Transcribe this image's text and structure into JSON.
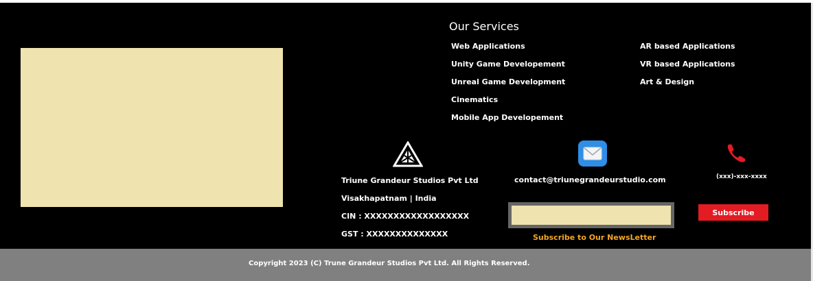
{
  "colors": {
    "background": "#000000",
    "placeholder": "#efe4b0",
    "subscribe_button": "#e31b23",
    "newsletter_caption": "#f5a623",
    "bottom_bar": "#808080"
  },
  "services": {
    "title": "Our Services",
    "left_column": [
      "Web Applications",
      "Unity Game Developement",
      "Unreal Game Development",
      "Cinematics",
      "Mobile App Developement"
    ],
    "right_column": [
      "AR based Applications",
      "VR based Applications",
      "Art & Design"
    ]
  },
  "company": {
    "icon": "company-logo-icon",
    "name": "Triune Grandeur Studios Pvt Ltd",
    "location": "Visakhapatnam | India",
    "cin": "CIN : XXXXXXXXXXXXXXXXXX",
    "gst": "GST : XXXXXXXXXXXXXX"
  },
  "contact": {
    "mail_icon": "mail-icon",
    "email": "contact@triunegrandeurstudio.com",
    "phone_icon": "phone-icon",
    "phone": "(xxx)-xxx-xxxx"
  },
  "newsletter": {
    "input_value": "",
    "subscribe_label": "Subscribe",
    "caption": "Subscribe to Our NewsLetter"
  },
  "footer": {
    "copyright": "Copyright 2023 (C) Trune Grandeur Studios Pvt Ltd. All Rights Reserved."
  }
}
